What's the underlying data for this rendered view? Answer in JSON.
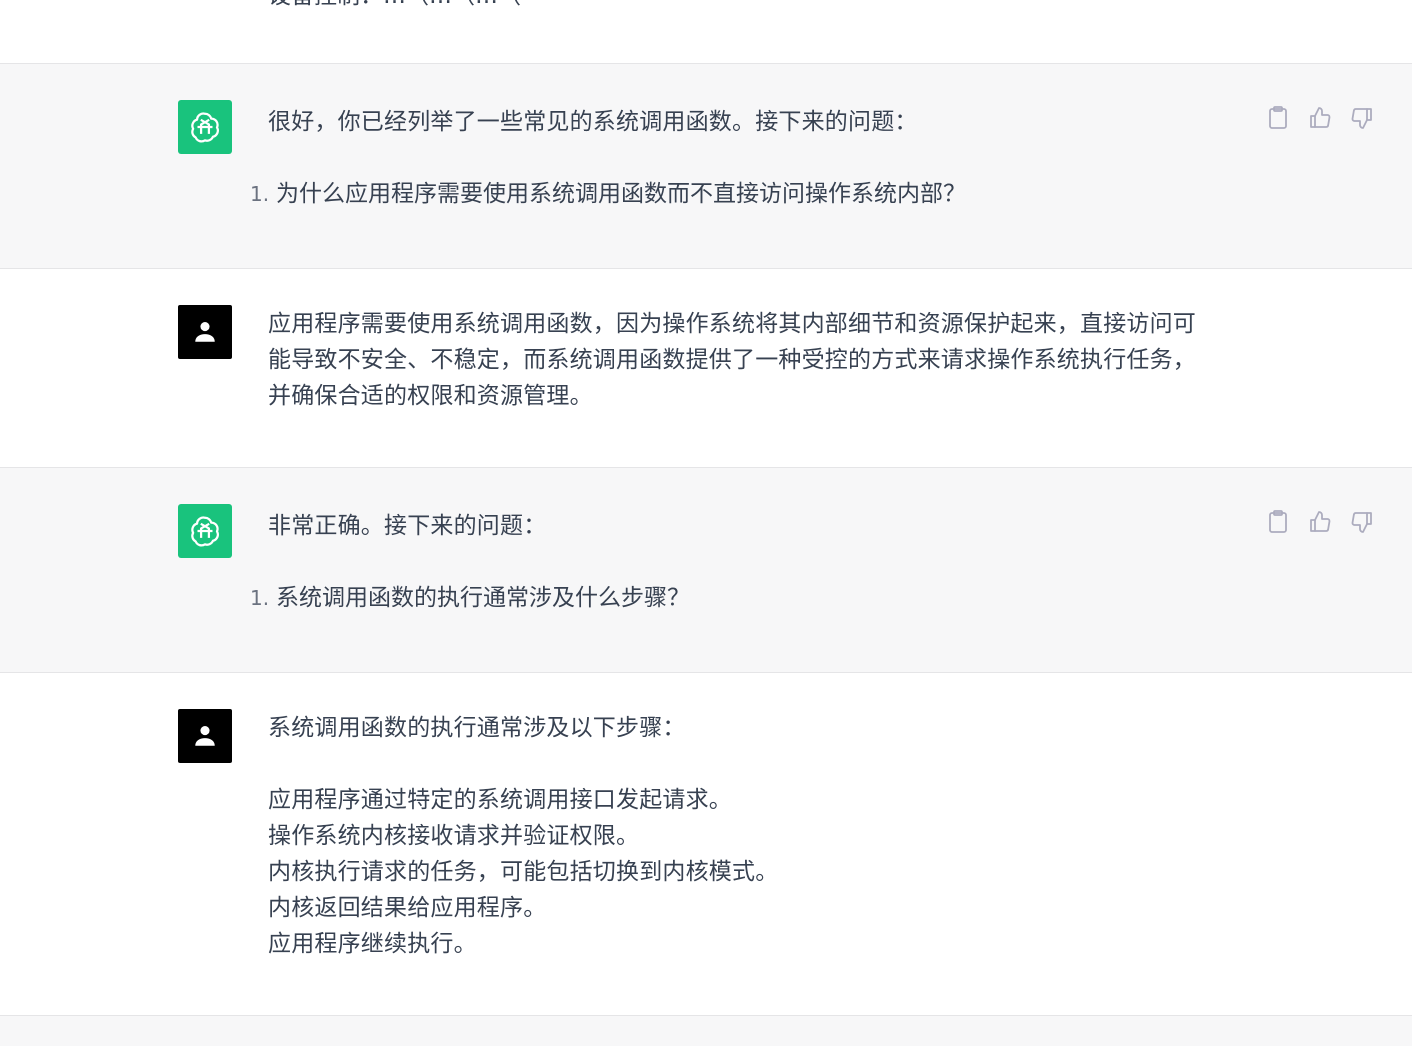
{
  "top_fragment": "设备控制：…（…（…（",
  "turns": [
    {
      "role": "assistant",
      "avatar_icon": "openai-logo-icon",
      "text": "很好，你已经列举了一些常见的系统调用函数。接下来的问题：",
      "list": [
        {
          "number": "1.",
          "text": "为什么应用程序需要使用系统调用函数而不直接访问操作系统内部？"
        }
      ]
    },
    {
      "role": "user",
      "avatar_icon": "user-icon",
      "lines": [
        "应用程序需要使用系统调用函数，因为操作系统将其内部细节和资源保护起来，直接访问可",
        "能导致不安全、不稳定，而系统调用函数提供了一种受控的方式来请求操作系统执行任务，",
        "并确保合适的权限和资源管理。"
      ]
    },
    {
      "role": "assistant",
      "avatar_icon": "openai-logo-icon",
      "text": "非常正确。接下来的问题：",
      "list": [
        {
          "number": "1.",
          "text": "系统调用函数的执行通常涉及什么步骤？"
        }
      ]
    },
    {
      "role": "user",
      "avatar_icon": "user-icon",
      "lines": [
        "系统调用函数的执行通常涉及以下步骤：",
        "",
        "应用程序通过特定的系统调用接口发起请求。",
        "操作系统内核接收请求并验证权限。",
        "内核执行请求的任务，可能包括切换到内核模式。",
        "内核返回结果给应用程序。",
        "应用程序继续执行。"
      ]
    }
  ],
  "actions": {
    "copy_icon": "clipboard-icon",
    "like_icon": "thumbs-up-icon",
    "dislike_icon": "thumbs-down-icon"
  },
  "colors": {
    "assistant_bg": "#f7f7f8",
    "gpt_avatar": "#19c37d",
    "user_avatar": "#000000",
    "text": "#374151",
    "icon": "#acacbe"
  }
}
